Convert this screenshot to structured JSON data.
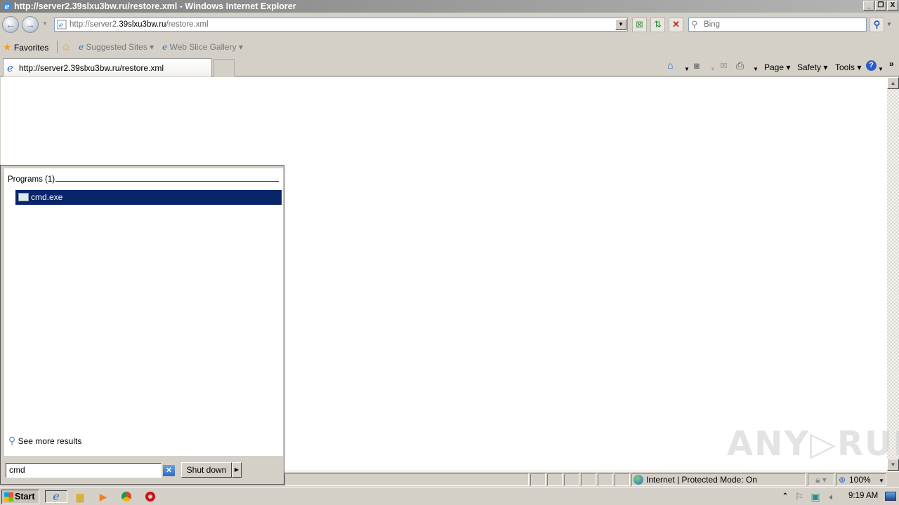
{
  "window": {
    "title": "http://server2.39slxu3bw.ru/restore.xml - Windows Internet Explorer",
    "controls": {
      "minimize": "_",
      "restore": "❐",
      "close": "X"
    }
  },
  "address_bar": {
    "url_prefix": "http://server2.",
    "url_domain": "39slxu3bw.ru",
    "url_path": "/restore.xml",
    "dropdown_icon": "▼"
  },
  "toolbar_buttons": {
    "compat": "compatibility-view-icon",
    "refresh": "refresh-icon",
    "stop": "stop-icon"
  },
  "search": {
    "placeholder": "Bing"
  },
  "favorites_bar": {
    "favorites_label": "Favorites",
    "items": [
      {
        "label": "Suggested Sites ▾"
      },
      {
        "label": "Web Slice Gallery ▾"
      }
    ]
  },
  "tabs": [
    {
      "label": "http://server2.39slxu3bw.ru/restore.xml",
      "active": true
    }
  ],
  "command_bar": {
    "page": "Page ▾",
    "safety": "Safety ▾",
    "tools": "Tools ▾",
    "more": "»"
  },
  "start_menu": {
    "section_header": "Programs (1)",
    "results": [
      {
        "label": "cmd.exe",
        "selected": true
      }
    ],
    "see_more": "See more results",
    "search_value": "cmd",
    "shutdown_label": "Shut down"
  },
  "status_bar": {
    "zone": "Internet | Protected Mode: On",
    "zoom": "100%"
  },
  "taskbar": {
    "start_label": "Start",
    "clock": "9:19 AM"
  },
  "watermark": "ANY▷RUN"
}
